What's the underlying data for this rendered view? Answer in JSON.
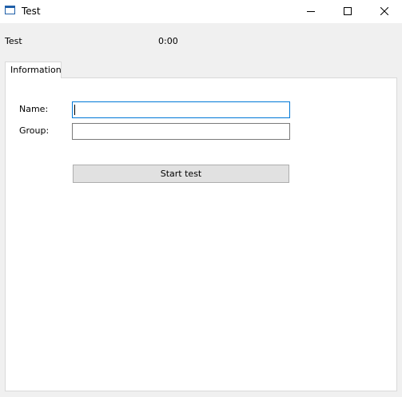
{
  "window": {
    "title": "Test",
    "icon": "window-icon"
  },
  "status": {
    "label": "Test",
    "timer": "0:00"
  },
  "tabs": [
    {
      "label": "Information",
      "selected": true
    }
  ],
  "form": {
    "name_label": "Name:",
    "name_value": "",
    "group_label": "Group:",
    "group_value": "",
    "start_button_label": "Start test"
  },
  "colors": {
    "focus_border": "#0078d7",
    "button_bg": "#e1e1e1",
    "window_bg": "#f0f0f0"
  }
}
